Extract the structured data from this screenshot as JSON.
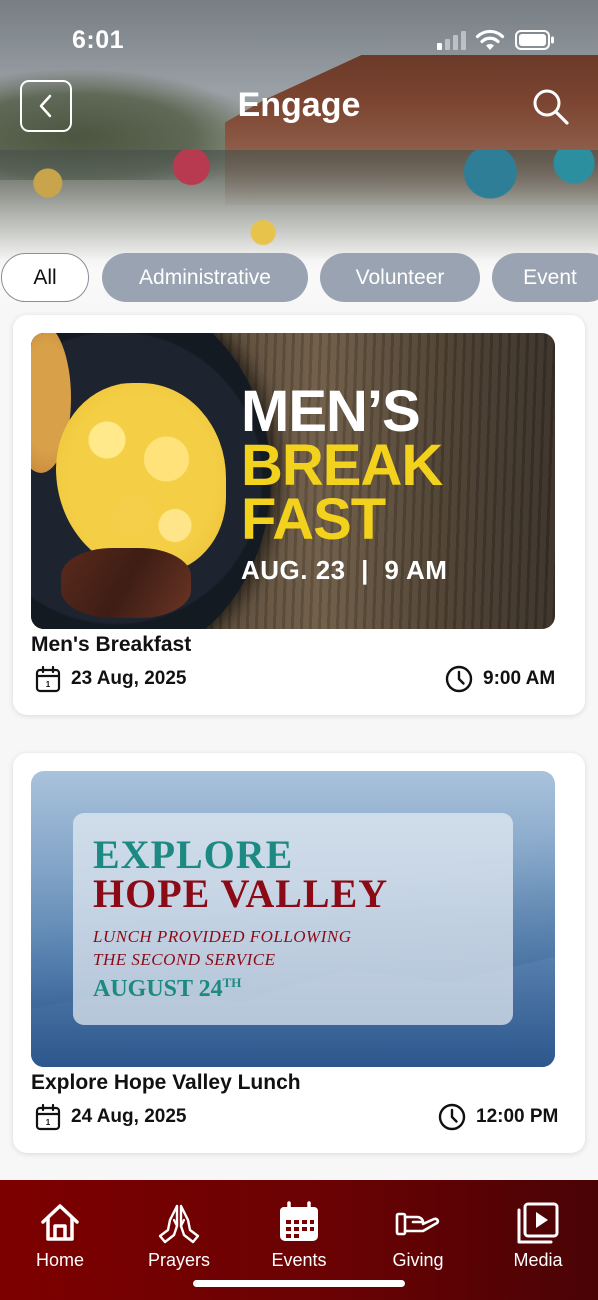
{
  "status_bar": {
    "time": "6:01"
  },
  "header": {
    "title": "Engage"
  },
  "filters": [
    {
      "label": "All",
      "active": true
    },
    {
      "label": "Administrative",
      "active": false
    },
    {
      "label": "Volunteer",
      "active": false
    },
    {
      "label": "Event",
      "active": false
    }
  ],
  "events": [
    {
      "title": "Men's Breakfast",
      "date": "23 Aug, 2025",
      "time": "9:00 AM",
      "banner": {
        "line1": "MEN’S",
        "line2": "BREAK",
        "line3": "FAST",
        "date_line": "AUG. 23  |  9 AM"
      }
    },
    {
      "title": "Explore Hope Valley Lunch",
      "date": "24 Aug, 2025",
      "time": "12:00 PM",
      "banner": {
        "line1": "EXPLORE",
        "line2": "HOPE VALLEY",
        "sub1": "LUNCH PROVIDED FOLLOWING",
        "sub2": "THE SECOND SERVICE",
        "date_main": "AUGUST 24",
        "date_suffix": "TH"
      }
    }
  ],
  "tabbar": [
    {
      "label": "Home",
      "icon": "home-icon"
    },
    {
      "label": "Prayers",
      "icon": "praying-hands-icon"
    },
    {
      "label": "Events",
      "icon": "calendar-icon"
    },
    {
      "label": "Giving",
      "icon": "giving-hand-icon"
    },
    {
      "label": "Media",
      "icon": "media-play-icon"
    }
  ],
  "colors": {
    "tabbar": "#7d0000",
    "chip_inactive": "#9aa3b2",
    "banner_yellow": "#f3d21d",
    "banner_teal": "#1c8a82",
    "banner_red": "#8b0a16"
  }
}
